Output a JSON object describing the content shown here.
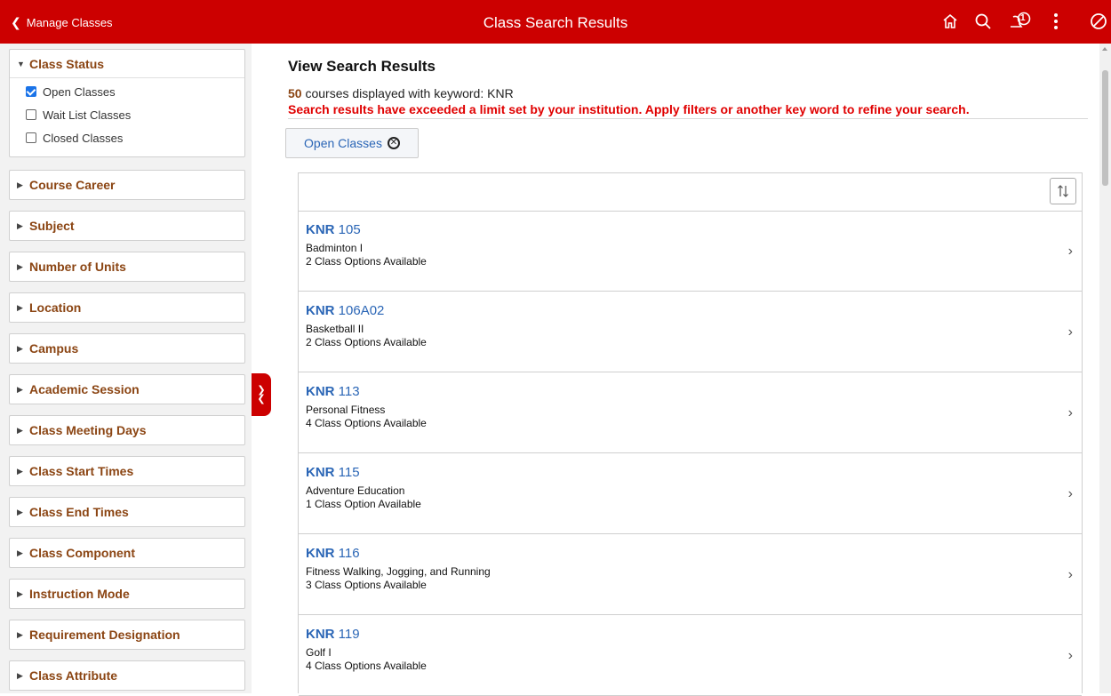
{
  "header": {
    "back_label": "Manage Classes",
    "title": "Class Search Results",
    "icons": [
      "home-icon",
      "search-icon",
      "notifications-icon",
      "more-icon",
      "navbar-icon"
    ],
    "notification_count": "1",
    "brand_color": "#cc0000"
  },
  "filters": {
    "class_status": {
      "label": "Class Status",
      "options": [
        {
          "label": "Open Classes",
          "checked": true
        },
        {
          "label": "Wait List Classes",
          "checked": false
        },
        {
          "label": "Closed Classes",
          "checked": false
        }
      ]
    },
    "facets": [
      "Course Career",
      "Subject",
      "Number of Units",
      "Location",
      "Campus",
      "Academic Session",
      "Class Meeting Days",
      "Class Start Times",
      "Class End Times",
      "Class Component",
      "Instruction Mode",
      "Requirement Designation",
      "Class Attribute"
    ]
  },
  "main": {
    "title": "View Search Results",
    "count": "50",
    "count_text": " courses displayed with keyword: KNR",
    "warning": "Search results have exceeded a limit set by your institution. Apply filters or another key word to refine your search.",
    "active_filter": "Open Classes",
    "results": [
      {
        "subject": "KNR",
        "number": " 105",
        "title": "Badminton I",
        "options": "2 Class Options Available"
      },
      {
        "subject": "KNR",
        "number": " 106A02",
        "title": "Basketball II",
        "options": "2 Class Options Available"
      },
      {
        "subject": "KNR",
        "number": " 113",
        "title": "Personal Fitness",
        "options": "4 Class Options Available"
      },
      {
        "subject": "KNR",
        "number": " 115",
        "title": "Adventure Education",
        "options": "1 Class Option Available"
      },
      {
        "subject": "KNR",
        "number": " 116",
        "title": "Fitness Walking, Jogging, and Running",
        "options": "3 Class Options Available"
      },
      {
        "subject": "KNR",
        "number": " 119",
        "title": "Golf I",
        "options": "4 Class Options Available"
      }
    ]
  }
}
